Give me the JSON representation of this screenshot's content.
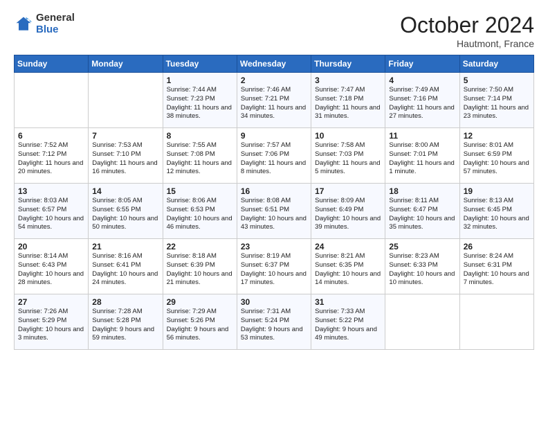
{
  "logo": {
    "general": "General",
    "blue": "Blue"
  },
  "title": "October 2024",
  "location": "Hautmont, France",
  "headers": [
    "Sunday",
    "Monday",
    "Tuesday",
    "Wednesday",
    "Thursday",
    "Friday",
    "Saturday"
  ],
  "weeks": [
    [
      {
        "day": "",
        "sunrise": "",
        "sunset": "",
        "daylight": ""
      },
      {
        "day": "",
        "sunrise": "",
        "sunset": "",
        "daylight": ""
      },
      {
        "day": "1",
        "sunrise": "Sunrise: 7:44 AM",
        "sunset": "Sunset: 7:23 PM",
        "daylight": "Daylight: 11 hours and 38 minutes."
      },
      {
        "day": "2",
        "sunrise": "Sunrise: 7:46 AM",
        "sunset": "Sunset: 7:21 PM",
        "daylight": "Daylight: 11 hours and 34 minutes."
      },
      {
        "day": "3",
        "sunrise": "Sunrise: 7:47 AM",
        "sunset": "Sunset: 7:18 PM",
        "daylight": "Daylight: 11 hours and 31 minutes."
      },
      {
        "day": "4",
        "sunrise": "Sunrise: 7:49 AM",
        "sunset": "Sunset: 7:16 PM",
        "daylight": "Daylight: 11 hours and 27 minutes."
      },
      {
        "day": "5",
        "sunrise": "Sunrise: 7:50 AM",
        "sunset": "Sunset: 7:14 PM",
        "daylight": "Daylight: 11 hours and 23 minutes."
      }
    ],
    [
      {
        "day": "6",
        "sunrise": "Sunrise: 7:52 AM",
        "sunset": "Sunset: 7:12 PM",
        "daylight": "Daylight: 11 hours and 20 minutes."
      },
      {
        "day": "7",
        "sunrise": "Sunrise: 7:53 AM",
        "sunset": "Sunset: 7:10 PM",
        "daylight": "Daylight: 11 hours and 16 minutes."
      },
      {
        "day": "8",
        "sunrise": "Sunrise: 7:55 AM",
        "sunset": "Sunset: 7:08 PM",
        "daylight": "Daylight: 11 hours and 12 minutes."
      },
      {
        "day": "9",
        "sunrise": "Sunrise: 7:57 AM",
        "sunset": "Sunset: 7:06 PM",
        "daylight": "Daylight: 11 hours and 8 minutes."
      },
      {
        "day": "10",
        "sunrise": "Sunrise: 7:58 AM",
        "sunset": "Sunset: 7:03 PM",
        "daylight": "Daylight: 11 hours and 5 minutes."
      },
      {
        "day": "11",
        "sunrise": "Sunrise: 8:00 AM",
        "sunset": "Sunset: 7:01 PM",
        "daylight": "Daylight: 11 hours and 1 minute."
      },
      {
        "day": "12",
        "sunrise": "Sunrise: 8:01 AM",
        "sunset": "Sunset: 6:59 PM",
        "daylight": "Daylight: 10 hours and 57 minutes."
      }
    ],
    [
      {
        "day": "13",
        "sunrise": "Sunrise: 8:03 AM",
        "sunset": "Sunset: 6:57 PM",
        "daylight": "Daylight: 10 hours and 54 minutes."
      },
      {
        "day": "14",
        "sunrise": "Sunrise: 8:05 AM",
        "sunset": "Sunset: 6:55 PM",
        "daylight": "Daylight: 10 hours and 50 minutes."
      },
      {
        "day": "15",
        "sunrise": "Sunrise: 8:06 AM",
        "sunset": "Sunset: 6:53 PM",
        "daylight": "Daylight: 10 hours and 46 minutes."
      },
      {
        "day": "16",
        "sunrise": "Sunrise: 8:08 AM",
        "sunset": "Sunset: 6:51 PM",
        "daylight": "Daylight: 10 hours and 43 minutes."
      },
      {
        "day": "17",
        "sunrise": "Sunrise: 8:09 AM",
        "sunset": "Sunset: 6:49 PM",
        "daylight": "Daylight: 10 hours and 39 minutes."
      },
      {
        "day": "18",
        "sunrise": "Sunrise: 8:11 AM",
        "sunset": "Sunset: 6:47 PM",
        "daylight": "Daylight: 10 hours and 35 minutes."
      },
      {
        "day": "19",
        "sunrise": "Sunrise: 8:13 AM",
        "sunset": "Sunset: 6:45 PM",
        "daylight": "Daylight: 10 hours and 32 minutes."
      }
    ],
    [
      {
        "day": "20",
        "sunrise": "Sunrise: 8:14 AM",
        "sunset": "Sunset: 6:43 PM",
        "daylight": "Daylight: 10 hours and 28 minutes."
      },
      {
        "day": "21",
        "sunrise": "Sunrise: 8:16 AM",
        "sunset": "Sunset: 6:41 PM",
        "daylight": "Daylight: 10 hours and 24 minutes."
      },
      {
        "day": "22",
        "sunrise": "Sunrise: 8:18 AM",
        "sunset": "Sunset: 6:39 PM",
        "daylight": "Daylight: 10 hours and 21 minutes."
      },
      {
        "day": "23",
        "sunrise": "Sunrise: 8:19 AM",
        "sunset": "Sunset: 6:37 PM",
        "daylight": "Daylight: 10 hours and 17 minutes."
      },
      {
        "day": "24",
        "sunrise": "Sunrise: 8:21 AM",
        "sunset": "Sunset: 6:35 PM",
        "daylight": "Daylight: 10 hours and 14 minutes."
      },
      {
        "day": "25",
        "sunrise": "Sunrise: 8:23 AM",
        "sunset": "Sunset: 6:33 PM",
        "daylight": "Daylight: 10 hours and 10 minutes."
      },
      {
        "day": "26",
        "sunrise": "Sunrise: 8:24 AM",
        "sunset": "Sunset: 6:31 PM",
        "daylight": "Daylight: 10 hours and 7 minutes."
      }
    ],
    [
      {
        "day": "27",
        "sunrise": "Sunrise: 7:26 AM",
        "sunset": "Sunset: 5:29 PM",
        "daylight": "Daylight: 10 hours and 3 minutes."
      },
      {
        "day": "28",
        "sunrise": "Sunrise: 7:28 AM",
        "sunset": "Sunset: 5:28 PM",
        "daylight": "Daylight: 9 hours and 59 minutes."
      },
      {
        "day": "29",
        "sunrise": "Sunrise: 7:29 AM",
        "sunset": "Sunset: 5:26 PM",
        "daylight": "Daylight: 9 hours and 56 minutes."
      },
      {
        "day": "30",
        "sunrise": "Sunrise: 7:31 AM",
        "sunset": "Sunset: 5:24 PM",
        "daylight": "Daylight: 9 hours and 53 minutes."
      },
      {
        "day": "31",
        "sunrise": "Sunrise: 7:33 AM",
        "sunset": "Sunset: 5:22 PM",
        "daylight": "Daylight: 9 hours and 49 minutes."
      },
      {
        "day": "",
        "sunrise": "",
        "sunset": "",
        "daylight": ""
      },
      {
        "day": "",
        "sunrise": "",
        "sunset": "",
        "daylight": ""
      }
    ]
  ]
}
